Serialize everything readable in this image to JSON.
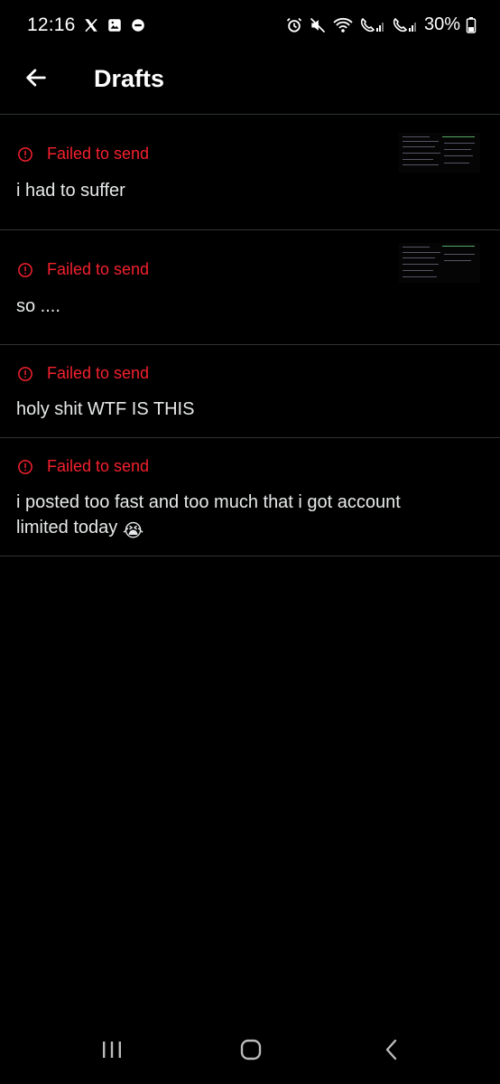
{
  "status_bar": {
    "time": "12:16",
    "battery": "30%",
    "left_icons": [
      "x-logo-icon",
      "gallery-icon",
      "do-not-disturb-icon"
    ],
    "right_icons": [
      "alarm-icon",
      "mute-icon",
      "wifi-calling-icon",
      "call-sim1-icon",
      "signal-bars-icon",
      "call-sim2-icon",
      "signal-bars-icon",
      "battery-icon"
    ]
  },
  "header": {
    "title": "Drafts",
    "back_icon": "arrow-left-icon"
  },
  "drafts": [
    {
      "status": "Failed to send",
      "text": "i had to suffer",
      "has_thumbnail": true
    },
    {
      "status": "Failed to send",
      "text": "so ....",
      "has_thumbnail": true
    },
    {
      "status": "Failed to send",
      "text": "holy shit WTF IS THIS",
      "has_thumbnail": false
    },
    {
      "status": "Failed to send",
      "text": "i posted too fast and too much that i got account limited today",
      "emoji": "😭",
      "has_thumbnail": false
    }
  ],
  "colors": {
    "background": "#000000",
    "error_red": "#f4212e",
    "text": "#e7e9ea",
    "divider": "#2f3336"
  },
  "nav_bar": {
    "icons": [
      "recent-apps-icon",
      "home-icon",
      "back-icon"
    ]
  }
}
